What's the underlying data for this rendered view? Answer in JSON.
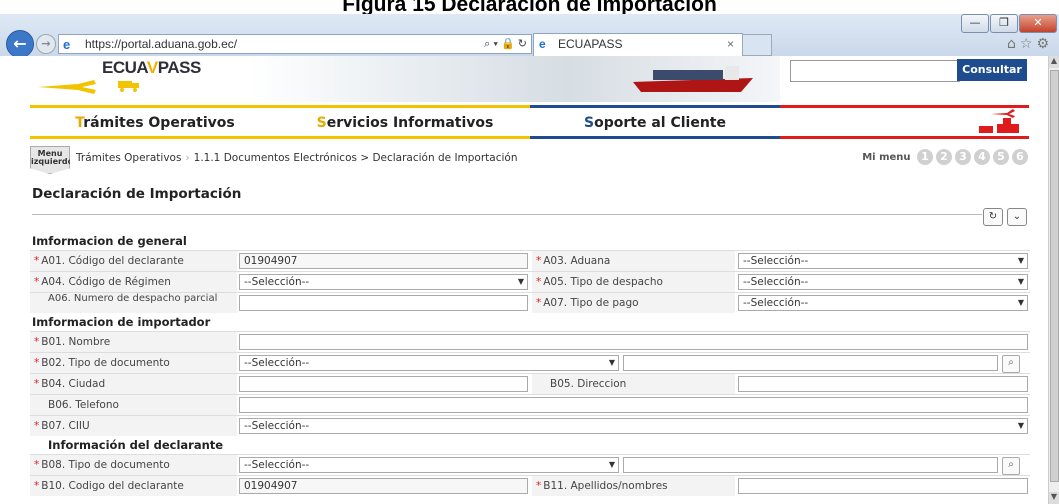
{
  "caption": "Figura 15 Declaración de Importación",
  "browser": {
    "url": "https://portal.aduana.gob.ec/",
    "tab_title": "ECUAPASS",
    "search_tools": "⌕ ▾ 🔒 ↻",
    "tab_close": "×",
    "win_min": "—",
    "win_max": "❐",
    "win_close": "✕"
  },
  "site": {
    "logo_main": "ECUA",
    "logo_v": "V",
    "logo_end": "PASS",
    "search_placeholder": "",
    "search_button": "Consultar"
  },
  "menu": [
    {
      "first": "T",
      "rest": "rámites Operativos"
    },
    {
      "first": "S",
      "rest": "ervicios Informativos"
    },
    {
      "first": "S",
      "rest": "oporte al Cliente"
    }
  ],
  "breadcrumb": {
    "menu_left": "Menu izquierdo",
    "item1": "Trámites Operativos",
    "item2": "1.1.1 Documentos Electrónicos > Declaración de Importación",
    "mi_menu": "Mi menu",
    "numbers": [
      "1",
      "2",
      "3",
      "4",
      "5",
      "6"
    ]
  },
  "page_title": "Declaración de Importación",
  "sections": {
    "general": "Imformacion de general",
    "importador": "Imformacion de importador",
    "declarante": "Información del declarante"
  },
  "fields": {
    "a01_label": "A01. Código del declarante",
    "a01_value": "01904907",
    "a03_label": "A03. Aduana",
    "a03_value": "--Selección--",
    "a04_label": "A04. Código de Régimen",
    "a04_value": "--Selección--",
    "a05_label": "A05. Tipo de despacho",
    "a05_value": "--Selección--",
    "a06_label": "A06. Numero de despacho parcial",
    "a06_value": "",
    "a07_label": "A07. Tipo de pago",
    "a07_value": "--Selección--",
    "b01_label": "B01. Nombre",
    "b01_value": "",
    "b02_label": "B02. Tipo de documento",
    "b02_value": "--Selección--",
    "b04_label": "B04. Ciudad",
    "b04_value": "",
    "b05_label": "B05. Direccion",
    "b05_value": "",
    "b06_label": "B06. Telefono",
    "b06_value": "",
    "b07_label": "B07. CIIU",
    "b07_value": "--Selección--",
    "b08_label": "B08. Tipo de documento",
    "b08_value": "--Selección--",
    "b10_label": "B10. Codigo del declarante",
    "b10_value": "01904907",
    "b11_label": "B11. Apellidos/nombres",
    "b11_value": ""
  },
  "icons": {
    "required": "*",
    "dropdown": "▼",
    "refresh": "↻",
    "collapse": "⌄",
    "search": "⌕"
  }
}
